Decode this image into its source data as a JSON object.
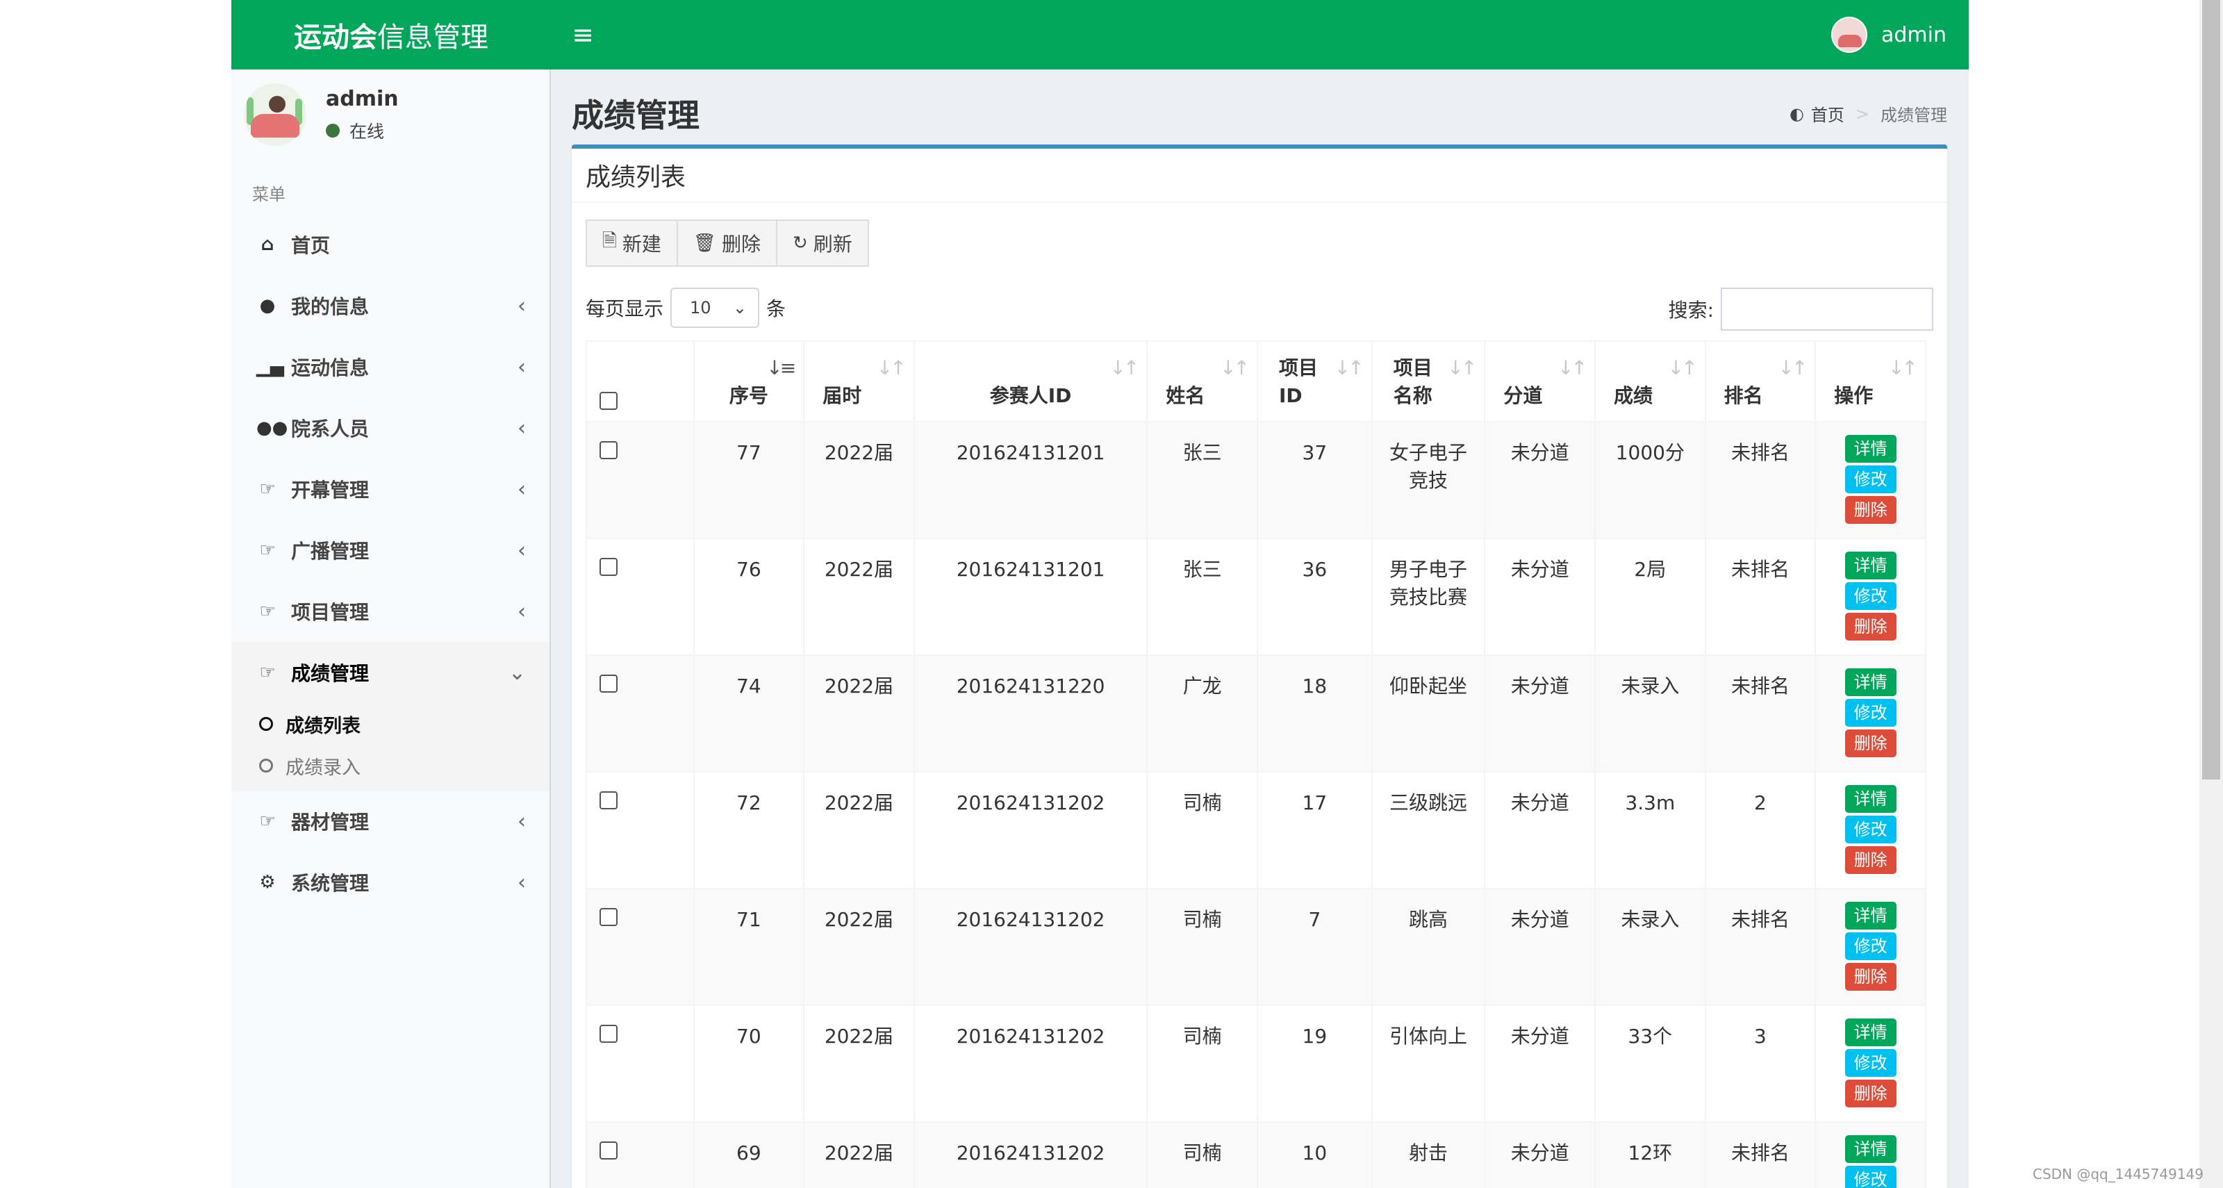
{
  "app": {
    "logo_bold": "运动会",
    "logo_rest": "信息管理",
    "user": "admin"
  },
  "sidebar": {
    "user_name": "admin",
    "status": "在线",
    "menu_header": "菜单",
    "items": [
      {
        "label": "首页",
        "icon": "home-icon"
      },
      {
        "label": "我的信息",
        "icon": "user-icon"
      },
      {
        "label": "运动信息",
        "icon": "bar-chart-icon"
      },
      {
        "label": "院系人员",
        "icon": "users-icon"
      },
      {
        "label": "开幕管理",
        "icon": "hand-point-icon"
      },
      {
        "label": "广播管理",
        "icon": "hand-point-icon"
      },
      {
        "label": "项目管理",
        "icon": "hand-point-icon"
      },
      {
        "label": "成绩管理",
        "icon": "hand-point-icon"
      },
      {
        "label": "器材管理",
        "icon": "hand-point-icon"
      },
      {
        "label": "系统管理",
        "icon": "gear-icon"
      }
    ],
    "sub_items": [
      "成绩列表",
      "成绩录入"
    ]
  },
  "page": {
    "title": "成绩管理",
    "breadcrumb_home": "首页",
    "breadcrumb_current": "成绩管理",
    "box_title": "成绩列表"
  },
  "toolbar": {
    "new_label": "新建",
    "delete_label": "删除",
    "refresh_label": "刷新"
  },
  "table_controls": {
    "length_prefix": "每页显示",
    "length_value": "10",
    "length_suffix": "条",
    "search_label": "搜索:",
    "search_value": ""
  },
  "table": {
    "headers": [
      "序号",
      "届时",
      "参赛人ID",
      "姓名",
      "项目\nID",
      "项目\n名称",
      "分道",
      "成绩",
      "排名",
      "操作"
    ],
    "action_labels": {
      "detail": "详情",
      "edit": "修改",
      "delete": "删除"
    },
    "rows": [
      [
        "77",
        "2022届",
        "201624131201",
        "张三",
        "37",
        "女子电子竞技",
        "未分道",
        "1000分",
        "未排名"
      ],
      [
        "76",
        "2022届",
        "201624131201",
        "张三",
        "36",
        "男子电子竞技比赛",
        "未分道",
        "2局",
        "未排名"
      ],
      [
        "74",
        "2022届",
        "201624131220",
        "广龙",
        "18",
        "仰卧起坐",
        "未分道",
        "未录入",
        "未排名"
      ],
      [
        "72",
        "2022届",
        "201624131202",
        "司楠",
        "17",
        "三级跳远",
        "未分道",
        "3.3m",
        "2"
      ],
      [
        "71",
        "2022届",
        "201624131202",
        "司楠",
        "7",
        "跳高",
        "未分道",
        "未录入",
        "未排名"
      ],
      [
        "70",
        "2022届",
        "201624131202",
        "司楠",
        "19",
        "引体向上",
        "未分道",
        "33个",
        "3"
      ],
      [
        "69",
        "2022届",
        "201624131202",
        "司楠",
        "10",
        "射击",
        "未分道",
        "12环",
        "未排名"
      ]
    ]
  },
  "watermark": "CSDN @qq_1445749149"
}
